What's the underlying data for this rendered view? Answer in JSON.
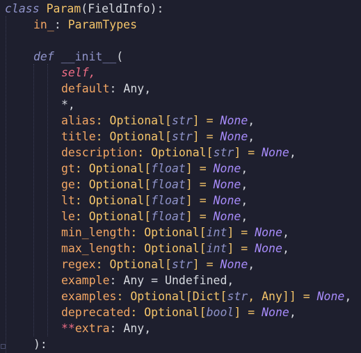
{
  "code": {
    "class_kw": "class",
    "class_name": "Param",
    "base": "(FieldInfo):",
    "in_line": {
      "name": "in_",
      "colon": ": ",
      "type": "ParamTypes"
    },
    "def_kw": "def",
    "init_name": "__init__",
    "init_open": "(",
    "self": "self,",
    "default": {
      "name": "default",
      "rest": ": Any,"
    },
    "star": "*,",
    "params": [
      {
        "name": "alias",
        "head": ": Optional[",
        "t": "str",
        "tail": "] = ",
        "none": "None",
        "end": ","
      },
      {
        "name": "title",
        "head": ": Optional[",
        "t": "str",
        "tail": "] = ",
        "none": "None",
        "end": ","
      },
      {
        "name": "description",
        "head": ": Optional[",
        "t": "str",
        "tail": "] = ",
        "none": "None",
        "end": ","
      },
      {
        "name": "gt",
        "head": ": Optional[",
        "t": "float",
        "tail": "] = ",
        "none": "None",
        "end": ","
      },
      {
        "name": "ge",
        "head": ": Optional[",
        "t": "float",
        "tail": "] = ",
        "none": "None",
        "end": ","
      },
      {
        "name": "lt",
        "head": ": Optional[",
        "t": "float",
        "tail": "] = ",
        "none": "None",
        "end": ","
      },
      {
        "name": "le",
        "head": ": Optional[",
        "t": "float",
        "tail": "] = ",
        "none": "None",
        "end": ","
      },
      {
        "name": "min_length",
        "head": ": Optional[",
        "t": "int",
        "tail": "] = ",
        "none": "None",
        "end": ","
      },
      {
        "name": "max_length",
        "head": ": Optional[",
        "t": "int",
        "tail": "] = ",
        "none": "None",
        "end": ","
      },
      {
        "name": "regex",
        "head": ": Optional[",
        "t": "str",
        "tail": "] = ",
        "none": "None",
        "end": ","
      }
    ],
    "example": {
      "name": "example",
      "rest": ": Any = Undefined,"
    },
    "examples": {
      "name": "examples",
      "head": ": Optional[Dict[",
      "t": "str",
      "mid": ", Any]] = ",
      "none": "None",
      "end": ","
    },
    "deprecated": {
      "name": "deprecated",
      "head": ": Optional[",
      "t": "bool",
      "tail": "] = ",
      "none": "None",
      "end": ","
    },
    "extra": {
      "stars": "**",
      "name": "extra",
      "rest": ": Any,"
    },
    "close": "):"
  }
}
